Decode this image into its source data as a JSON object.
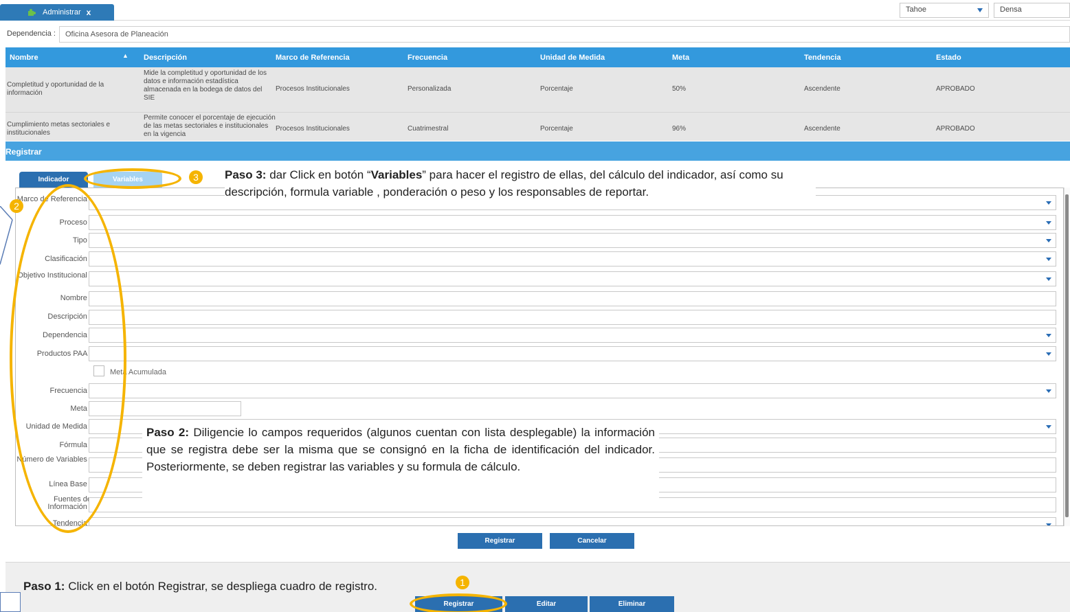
{
  "topbar": {
    "tab_label": "Administrar",
    "tab_close": "x",
    "theme_select": "Tahoe",
    "density_select": "Densa"
  },
  "dependencia": {
    "label": "Dependencia :",
    "value": "Oficina Asesora de Planeación"
  },
  "grid": {
    "columns": [
      "Nombre",
      "Descripción",
      "Marco de Referencia",
      "Frecuencia",
      "Unidad de Medida",
      "Meta",
      "Tendencia",
      "Estado"
    ],
    "rows": [
      {
        "nombre": "Completitud y oportunidad de la información",
        "descripcion": "Mide la completitud y oportunidad de los datos e información estadística almacenada en la bodega de datos del SIE",
        "marco": "Procesos Institucionales",
        "frecuencia": "Personalizada",
        "unidad": "Porcentaje",
        "meta": "50%",
        "tendencia": "Ascendente",
        "estado": "APROBADO"
      },
      {
        "nombre": "Cumplimiento metas sectoriales e institucionales",
        "descripcion": "Permite conocer el porcentaje de ejecución de las metas sectoriales e institucionales en la vigencia",
        "marco": "Procesos Institucionales",
        "frecuencia": "Cuatrimestral",
        "unidad": "Porcentaje",
        "meta": "96%",
        "tendencia": "Ascendente",
        "estado": "APROBADO"
      }
    ]
  },
  "registrar_panel": {
    "title": "Registrar",
    "tabs": [
      "Indicador",
      "Variables"
    ],
    "fields": {
      "marco_referencia": "Marco de Referencia :",
      "proceso": "Proceso :",
      "tipo": "Tipo :",
      "clasificacion": "Clasificación :",
      "objetivo": "Objetivo Institucional :",
      "nombre": "Nombre :",
      "descripcion": "Descripción :",
      "dependencia": "Dependencia :",
      "productos_paa": "Productos PAA :",
      "meta_acumulada": "Meta Acumulada",
      "frecuencia": "Frecuencia :",
      "meta": "Meta :",
      "unidad_medida": "Unidad de Medida :",
      "formula": "Fórmula :",
      "numero_variables": "Número de Variables :",
      "linea_base": "Línea Base :",
      "fuentes": "Fuentes de Información :",
      "tendencia": "Tendencia :"
    },
    "buttons": {
      "registrar": "Registrar",
      "cancelar": "Cancelar"
    }
  },
  "bottom_toolbar": {
    "registrar": "Registrar",
    "editar": "Editar",
    "eliminar": "Eliminar"
  },
  "callouts": {
    "paso3_title": "Paso 3:",
    "paso3_text_a": " dar Click en botón “",
    "paso3_bold": "Variables",
    "paso3_text_b": "” para hacer  el registro de ellas, del cálculo del  indicador, así como su descripción, formula variable , ponderación o peso y los responsables de reportar.",
    "paso2_title": "Paso 2:",
    "paso2_text": " Diligencie lo campos requeridos (algunos cuentan con lista desplegable) la información que se registra debe ser la misma que se consignó en la ficha de identificación del indicador. Posteriormente,  se deben registrar las variables y su formula de cálculo.",
    "paso1_title": "Paso 1:",
    "paso1_text": " Click en el botón Registrar, se despliega cuadro de registro.",
    "numbers": [
      "1",
      "2",
      "3"
    ]
  },
  "colors": {
    "accent": "#2b6fb0",
    "header": "#3399dd",
    "highlight": "#f5b400"
  }
}
